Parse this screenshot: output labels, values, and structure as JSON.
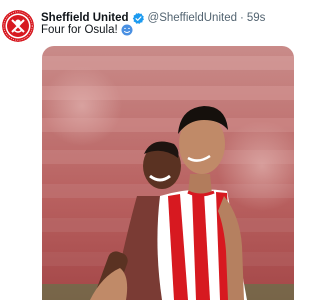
{
  "tweet": {
    "author_name": "Sheffield United",
    "handle": "@SheffieldUnited",
    "separator": "·",
    "time": "59s",
    "text": "Four for Osula!",
    "emoji_icon": "blue-heart-eyes-emoji-icon"
  },
  "media": {
    "description_icon": "football-players-photo"
  },
  "colors": {
    "verified": "#1d9bf0",
    "club_red": "#d71920",
    "secondary_text": "#536471"
  }
}
